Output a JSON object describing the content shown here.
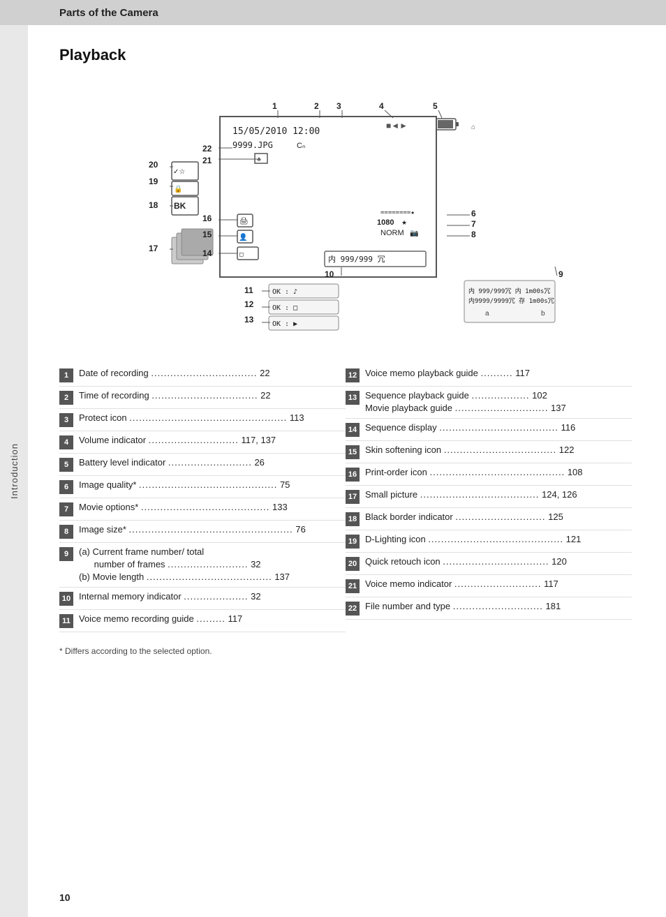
{
  "topBar": {
    "title": "Parts of the Camera"
  },
  "sidebar": {
    "label": "Introduction"
  },
  "section": {
    "title": "Playback"
  },
  "items": [
    {
      "num": "1",
      "text": "Date of recording",
      "dots": ".................................",
      "page": "22"
    },
    {
      "num": "2",
      "text": "Time of recording",
      "dots": ".................................",
      "page": "22"
    },
    {
      "num": "3",
      "text": "Protect icon",
      "dots": ".................................................",
      "page": "113"
    },
    {
      "num": "4",
      "text": "Volume indicator",
      "dots": "............................",
      "page": "117, 137"
    },
    {
      "num": "5",
      "text": "Battery level indicator",
      "dots": "............................",
      "page": "26"
    },
    {
      "num": "6",
      "text": "Image quality",
      "dots": "*.................................................",
      "page": "75"
    },
    {
      "num": "7",
      "text": "Movie options",
      "dots": "*...........................................",
      "page": "133"
    },
    {
      "num": "8",
      "text": "Image size",
      "dots": "*.......................................................",
      "page": "76"
    },
    {
      "num": "9",
      "text": "(a) Current frame number/ total\n      number of frames",
      "dots": ".........................",
      "page": "32\n(b) Movie length ........................................137"
    },
    {
      "num": "10",
      "text": "Internal memory indicator",
      "dots": "......................",
      "page": "32"
    },
    {
      "num": "11",
      "text": "Voice memo recording guide",
      "dots": ".........",
      "page": "117"
    },
    {
      "num": "12",
      "text": "Voice memo playback guide",
      "dots": "..........",
      "page": "117"
    },
    {
      "num": "13",
      "text": "Sequence playback guide",
      "dots": "...................",
      "page": "102\nMovie playback guide ............................. 137"
    },
    {
      "num": "14",
      "text": "Sequence display",
      "dots": ".....................................",
      "page": "116"
    },
    {
      "num": "15",
      "text": "Skin softening icon",
      "dots": "...................................",
      "page": "122"
    },
    {
      "num": "16",
      "text": "Print-order icon",
      "dots": "...........................................",
      "page": "108"
    },
    {
      "num": "17",
      "text": "Small picture",
      "dots": ".....................................",
      "page": "124, 126"
    },
    {
      "num": "18",
      "text": "Black border indicator",
      "dots": "............................",
      "page": "125"
    },
    {
      "num": "19",
      "text": "D-Lighting icon",
      "dots": "...........................................",
      "page": "121"
    },
    {
      "num": "20",
      "text": "Quick retouch icon",
      "dots": "...................................",
      "page": "120"
    },
    {
      "num": "21",
      "text": "Voice memo indicator",
      "dots": "...........................",
      "page": "117"
    },
    {
      "num": "22",
      "text": "File number and type",
      "dots": "............................",
      "page": "181"
    }
  ],
  "footnote": "*  Differs according to the selected option.",
  "pageNumber": "10"
}
